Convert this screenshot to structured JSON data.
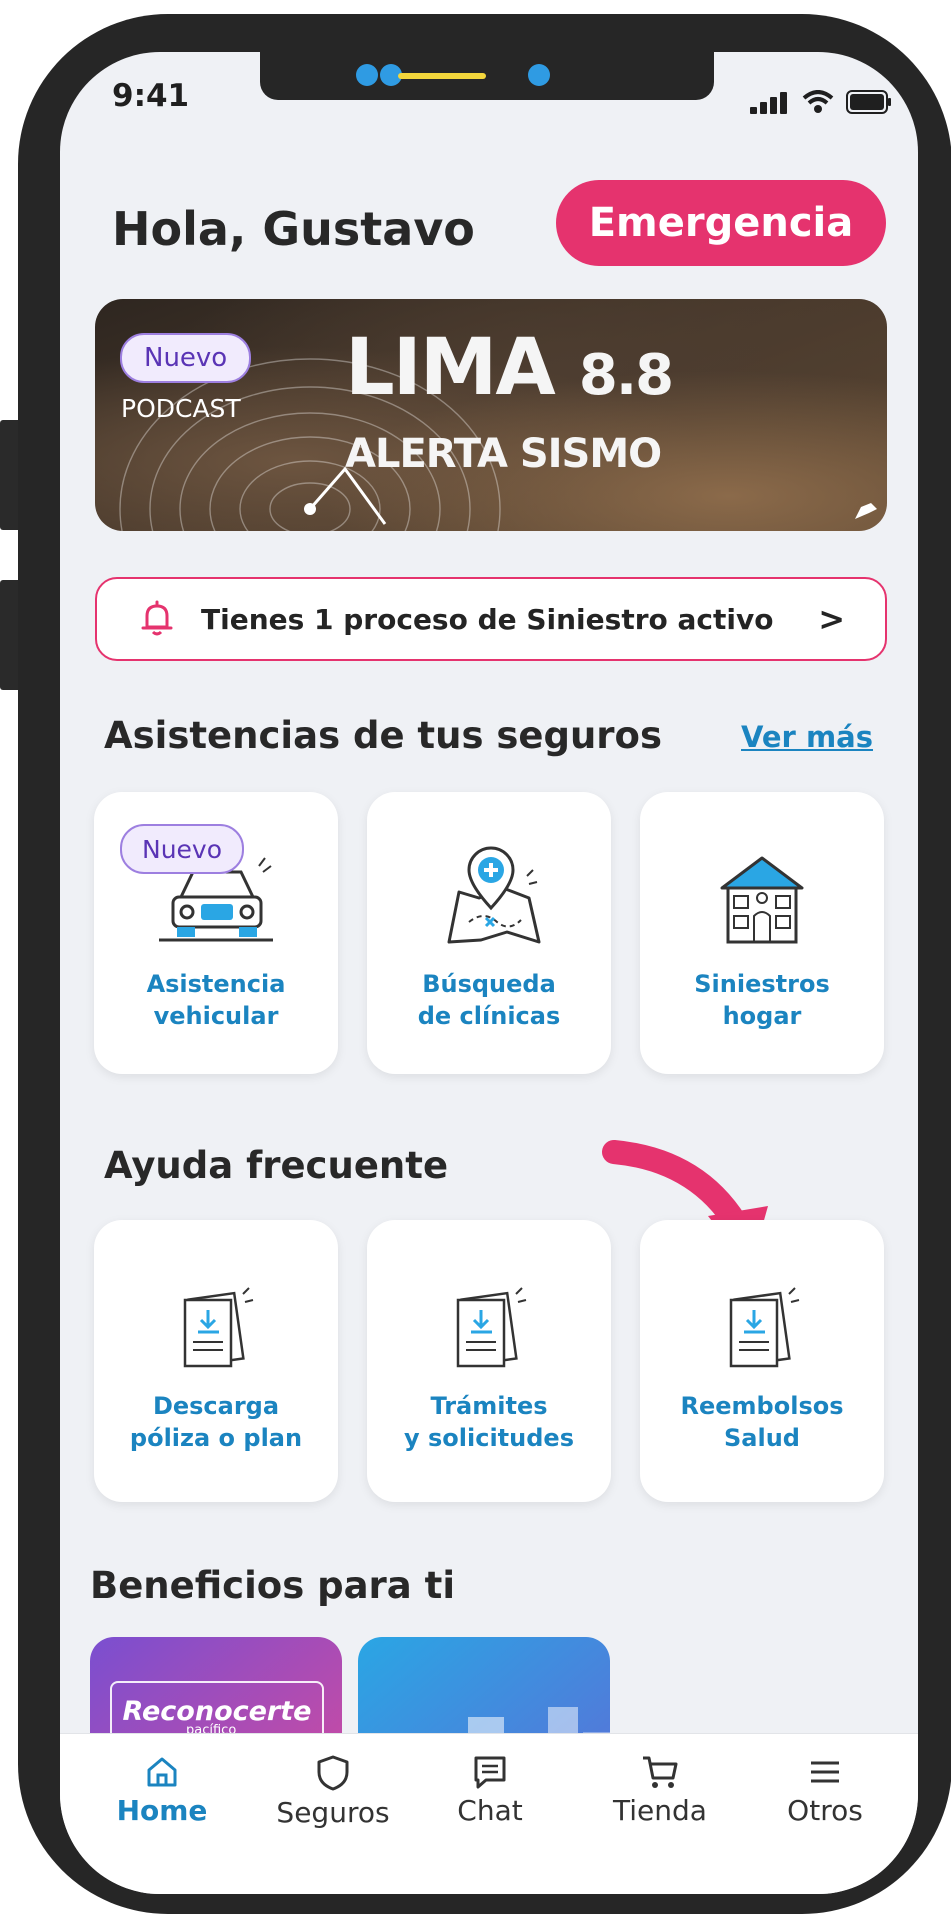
{
  "status_bar": {
    "time": "9:41"
  },
  "header": {
    "greeting": "Hola, Gustavo",
    "emergency_label": "Emergencia"
  },
  "banner": {
    "badge": "Nuevo",
    "kicker": "PODCAST",
    "title_main": "LIMA",
    "title_number": "8.8",
    "subtitle": "ALERTA SISMO"
  },
  "alert": {
    "text": "Tienes 1 proceso de Siniestro activo",
    "chevron": ">"
  },
  "assistances": {
    "title": "Asistencias de tus seguros",
    "see_more": "Ver más",
    "cards": [
      {
        "badge": "Nuevo",
        "line1": "Asistencia",
        "line2": "vehicular",
        "icon": "car-icon"
      },
      {
        "line1": "Búsqueda",
        "line2": "de clínicas",
        "icon": "map-pin-icon"
      },
      {
        "line1": "Siniestros",
        "line2": "hogar",
        "icon": "house-icon"
      }
    ]
  },
  "help": {
    "title": "Ayuda frecuente",
    "cards": [
      {
        "line1": "Descarga",
        "line2": "póliza o plan",
        "icon": "document-download-icon"
      },
      {
        "line1": "Trámites",
        "line2": "y solicitudes",
        "icon": "document-download-icon"
      },
      {
        "line1": "Reembolsos",
        "line2": "Salud",
        "icon": "document-download-icon"
      }
    ]
  },
  "benefits": {
    "title": "Beneficios para ti",
    "promo1_logo": "Reconocerte",
    "promo1_sub": "pacífico"
  },
  "tabbar": {
    "items": [
      {
        "label": "Home",
        "icon": "home-icon",
        "active": true
      },
      {
        "label": "Seguros",
        "icon": "shield-icon"
      },
      {
        "label": "Chat",
        "icon": "chat-icon"
      },
      {
        "label": "Tienda",
        "icon": "cart-icon"
      },
      {
        "label": "Otros",
        "icon": "menu-icon"
      }
    ]
  },
  "colors": {
    "accent_pink": "#e5336e",
    "link_blue": "#1b84c0",
    "badge_purple": "#5a34b5"
  }
}
